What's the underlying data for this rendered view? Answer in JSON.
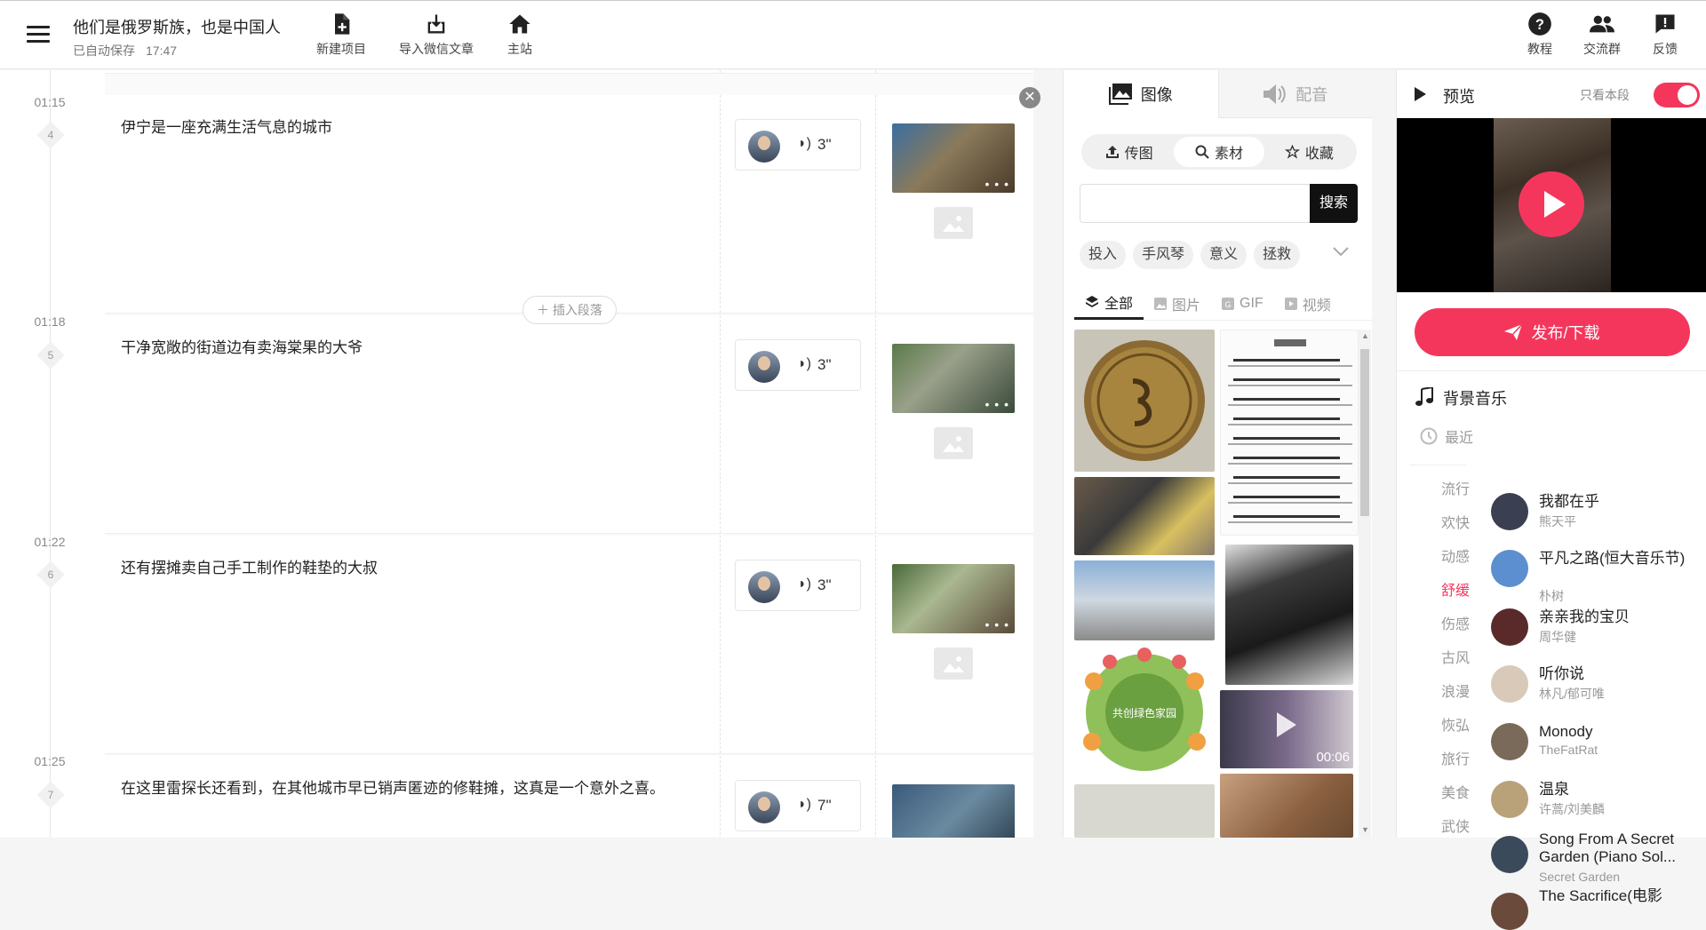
{
  "header": {
    "project_title": "他们是俄罗斯族，也是中国人",
    "autosave_label": "已自动保存",
    "autosave_time": "17:47",
    "buttons": {
      "new_project": "新建项目",
      "import_wechat": "导入微信文章",
      "home": "主站",
      "tutorial": "教程",
      "community": "交流群",
      "feedback": "反馈"
    }
  },
  "timeline": [
    {
      "time": "01:15",
      "index": "4"
    },
    {
      "time": "01:18",
      "index": "5"
    },
    {
      "time": "01:22",
      "index": "6"
    },
    {
      "time": "01:25",
      "index": "7"
    }
  ],
  "segments": [
    {
      "text": "伊宁是一座充满生活气息的城市",
      "duration": "3\"",
      "thumb_color": "#6a7a5e"
    },
    {
      "text": "干净宽敞的街道边有卖海棠果的大爷",
      "duration": "3\"",
      "thumb_color": "#7d8a6c"
    },
    {
      "text": "还有摆摊卖自己手工制作的鞋垫的大叔",
      "duration": "3\"",
      "thumb_color": "#6f7b58"
    },
    {
      "text": "在这里雷探长还看到，在其他城市早已销声匿迹的修鞋摊，这真是一个意外之喜。",
      "duration": "7\"",
      "thumb_color": "#4d6a8a"
    }
  ],
  "insert_paragraph": "插入段落",
  "more_dots": "• • •",
  "media": {
    "tabs": {
      "image": "图像",
      "audio": "配音"
    },
    "sources": {
      "upload": "传图",
      "material": "素材",
      "favorites": "收藏"
    },
    "search": {
      "value": "",
      "button": "搜索"
    },
    "keywords": [
      "投入",
      "手风琴",
      "意义",
      "拯救"
    ],
    "filters": {
      "all": "全部",
      "pictures": "图片",
      "gif": "GIF",
      "video": "视频"
    },
    "video_duration": "00:06",
    "green_poster_text": "共创绿色家园"
  },
  "preview": {
    "title": "预览",
    "only_this_segment": "只看本段",
    "publish": "发布/下载",
    "bgm_title": "背景音乐",
    "recent": "最近",
    "categories": [
      "流行",
      "欢快",
      "动感",
      "舒缓",
      "伤感",
      "古风",
      "浪漫",
      "恢弘",
      "旅行",
      "美食",
      "武侠"
    ],
    "active_category": "舒缓",
    "songs": [
      {
        "name": "我都在乎",
        "artist": "熊天平",
        "cover": "#3b3f52"
      },
      {
        "name": "平凡之路(恒大音乐节)",
        "artist": "朴树",
        "cover": "#5b8fd0"
      },
      {
        "name": "亲亲我的宝贝",
        "artist": "周华健",
        "cover": "#5a2a2a"
      },
      {
        "name": "听你说",
        "artist": "林凡/郁可唯",
        "cover": "#d9c9b8"
      },
      {
        "name": "Monody",
        "artist": "TheFatRat",
        "cover": "#7a6a5a"
      },
      {
        "name": "温泉",
        "artist": "许蒿/刘美麟",
        "cover": "#b9a27a"
      },
      {
        "name": "Song From A Secret Garden (Piano Sol...",
        "artist": "Secret Garden",
        "cover": "#3a4a5a"
      },
      {
        "name": "The Sacrifice(电影",
        "artist": "",
        "cover": "#6a4a3a"
      }
    ]
  }
}
